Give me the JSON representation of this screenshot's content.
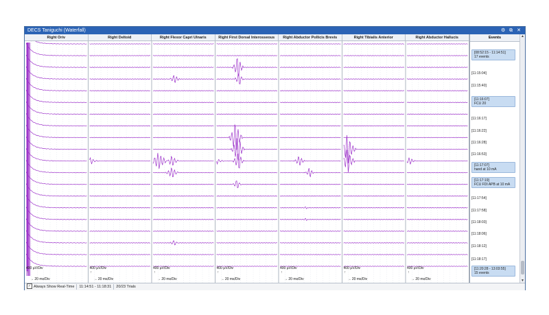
{
  "window": {
    "title": "DECS Taniguchi (Waterfall)",
    "controls": [
      "⚙",
      "⧉",
      "✕"
    ]
  },
  "channels": [
    "Right Oriv",
    "Right Deltoid",
    "Right Flexor Capri Ulnaris",
    "Right First Dorsal Interosseous",
    "Right Abductor Pollicis Brevis",
    "Right Tibialis Anterior",
    "Right Abductor Hallucis"
  ],
  "events_header": "Events",
  "scale": {
    "amplitude": "400 µV/Div",
    "time": "20 ms/Div"
  },
  "events": [
    {
      "type": "box",
      "line1": "[08:52:15 - 11:14:51]",
      "line2": "17 events"
    },
    {
      "type": "text",
      "line1": "[11:15:04]"
    },
    {
      "type": "text",
      "line1": "[11:15:40]"
    },
    {
      "type": "box",
      "line1": "[11:16:07]",
      "line2": "FCU 20"
    },
    {
      "type": "text",
      "line1": "[11:16:17]"
    },
    {
      "type": "text",
      "line1": "[11:16:22]"
    },
    {
      "type": "text",
      "line1": "[11:16:28]"
    },
    {
      "type": "text",
      "line1": "[11:16:53]"
    },
    {
      "type": "box",
      "line1": "[11:17:07]",
      "line2": "hand at 10 mA"
    },
    {
      "type": "box",
      "line1": "[11:17:19]",
      "line2": "FCU FDI APB at 10 mA"
    },
    {
      "type": "text",
      "line1": "[11:17:54]"
    },
    {
      "type": "text",
      "line1": "[11:17:58]"
    },
    {
      "type": "text",
      "line1": "[11:18:03]"
    },
    {
      "type": "text",
      "line1": "[11:18:06]"
    },
    {
      "type": "text",
      "line1": "[11:18:12]"
    },
    {
      "type": "text",
      "line1": "[11:18:17]"
    },
    {
      "type": "box",
      "line1": "[11:20:28 - 13:03:55]",
      "line2": "15 events"
    }
  ],
  "status": {
    "checkbox_label": "Always Show Real-Time",
    "range": "11:14:51 - 11:18:31",
    "trials": "20/23 Trials"
  },
  "colors": {
    "trace": "#9b2fc9",
    "title_bar": "#2b63b5",
    "event_box": "#c8dcf2"
  }
}
